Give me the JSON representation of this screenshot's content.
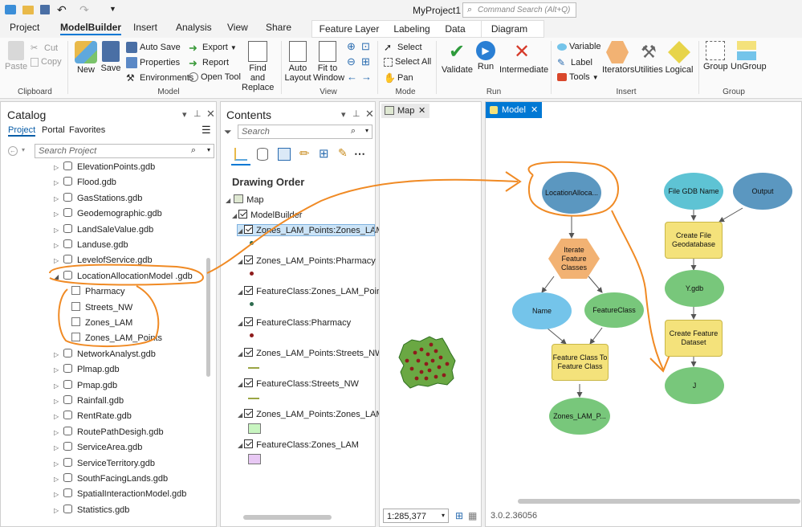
{
  "title": "MyProject1",
  "command_search_placeholder": "Command Search (Alt+Q)",
  "ribbon_tabs": [
    "Project",
    "ModelBuilder",
    "Insert",
    "Analysis",
    "View",
    "Share"
  ],
  "context_tabs": [
    "Feature Layer",
    "Labeling",
    "Data",
    "Diagram"
  ],
  "ribbon": {
    "clipboard": {
      "paste": "Paste",
      "cut": "Cut",
      "copy": "Copy",
      "label": "Clipboard"
    },
    "model": {
      "new": "New",
      "save": "Save",
      "auto_save": "Auto Save",
      "properties": "Properties",
      "environments": "Environments",
      "export": "Export",
      "report": "Report",
      "open_tool": "Open Tool",
      "find_replace_1": "Find and",
      "find_replace_2": "Replace",
      "label": "Model"
    },
    "view": {
      "auto_layout_1": "Auto",
      "auto_layout_2": "Layout",
      "fit_1": "Fit to",
      "fit_2": "Window",
      "label": "View"
    },
    "mode": {
      "select": "Select",
      "select_all": "Select All",
      "pan": "Pan",
      "label": "Mode"
    },
    "run": {
      "validate": "Validate",
      "run": "Run",
      "intermediate": "Intermediate",
      "label": "Run"
    },
    "insert": {
      "variable": "Variable",
      "label_item": "Label",
      "tools": "Tools",
      "iterators": "Iterators",
      "utilities": "Utilities",
      "logical": "Logical",
      "label": "Insert"
    },
    "group": {
      "group": "Group",
      "ungroup": "UnGroup",
      "label": "Group"
    }
  },
  "catalog": {
    "title": "Catalog",
    "tabs": [
      "Project",
      "Portal",
      "Favorites"
    ],
    "search_placeholder": "Search Project",
    "items": [
      "ElevationPoints.gdb",
      "Flood.gdb",
      "GasStations.gdb",
      "Geodemographic.gdb",
      "LandSaleValue.gdb",
      "Landuse.gdb",
      "LevelofService.gdb",
      "LocationAllocationModel .gdb"
    ],
    "children": [
      "Pharmacy",
      "Streets_NW",
      "Zones_LAM",
      "Zones_LAM_Points"
    ],
    "items_after": [
      "NetworkAnalyst.gdb",
      "Plmap.gdb",
      "Pmap.gdb",
      "Rainfall.gdb",
      "RentRate.gdb",
      "RoutePathDesigh.gdb",
      "ServiceArea.gdb",
      "ServiceTerritory.gdb",
      "SouthFacingLands.gdb",
      "SpatialInteractionModel.gdb",
      "Statistics.gdb"
    ]
  },
  "contents": {
    "title": "Contents",
    "search_placeholder": "Search",
    "drawing_order": "Drawing Order",
    "map": "Map",
    "group": "ModelBuilder",
    "layers": [
      "Zones_LAM_Points:Zones_LAM_Poi",
      "Zones_LAM_Points:Pharmacy",
      "FeatureClass:Zones_LAM_Points",
      "FeatureClass:Pharmacy",
      "Zones_LAM_Points:Streets_NW",
      "FeatureClass:Streets_NW",
      "Zones_LAM_Points:Zones_LAM",
      "FeatureClass:Zones_LAM"
    ]
  },
  "map_tab": "Map",
  "model_tab": "Model",
  "scale": "1:285,377",
  "version": "3.0.2.36056",
  "model_nodes": {
    "location": "LocationAlloca...",
    "iterate": "Iterate Feature Classes",
    "name": "Name",
    "featureclass": "FeatureClass",
    "fc_to_fc": "Feature Class To Feature Class",
    "zones_out": "Zones_LAM_P...",
    "gdb_name": "File GDB Name",
    "output": "Output",
    "create_gdb": "Create File Geodatabase",
    "ygdb": "Y.gdb",
    "create_fd": "Create Feature Dataset",
    "j": "J"
  },
  "colors": {
    "accent": "#0078d4",
    "annotation": "#f08a24"
  }
}
